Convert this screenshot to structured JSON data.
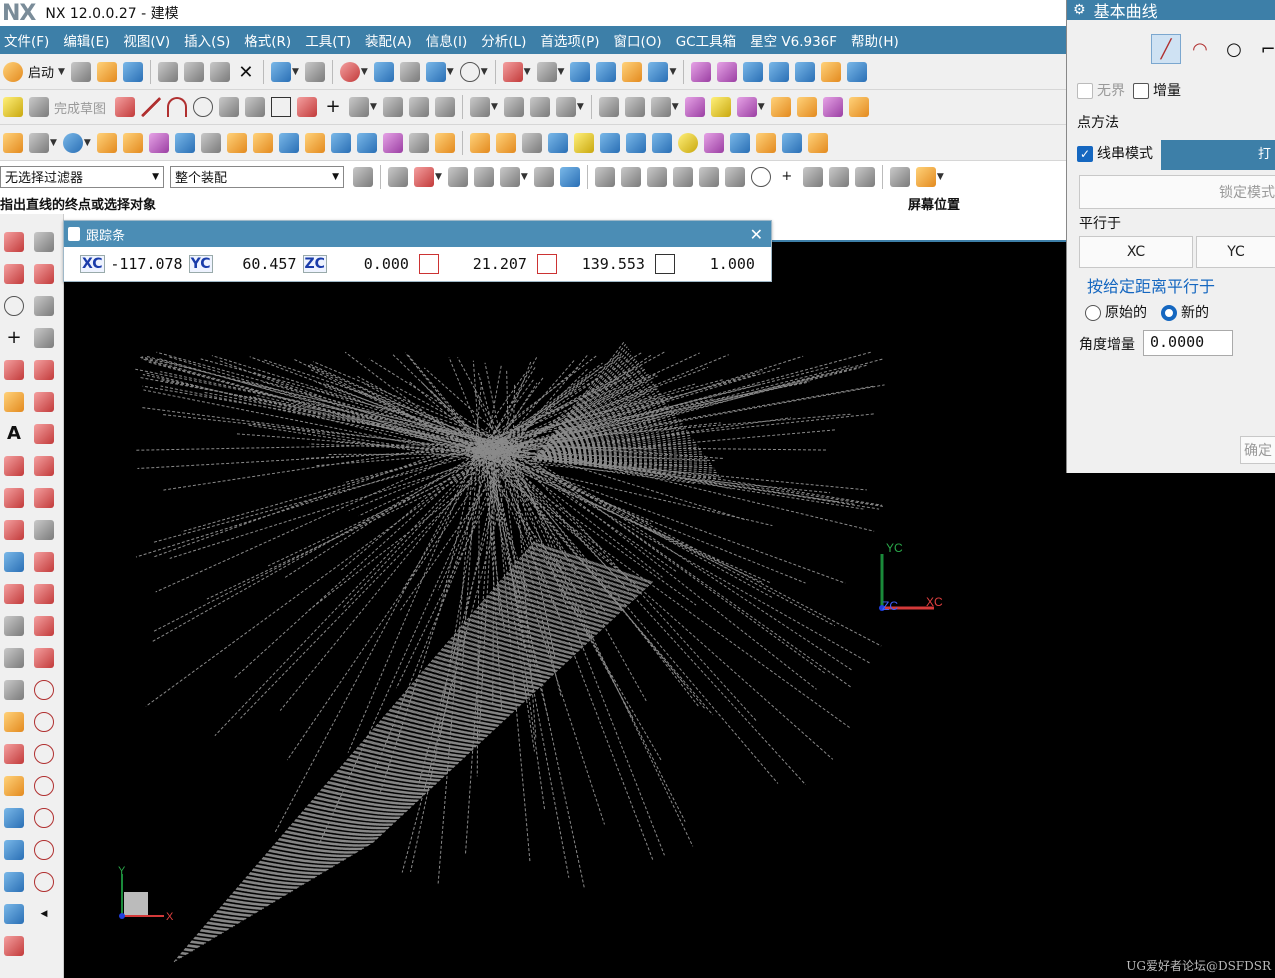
{
  "app": {
    "logo": "NX",
    "title": "NX 12.0.0.27 - 建模"
  },
  "menu": [
    "文件(F)",
    "编辑(E)",
    "视图(V)",
    "插入(S)",
    "格式(R)",
    "工具(T)",
    "装配(A)",
    "信息(I)",
    "分析(L)",
    "首选项(P)",
    "窗口(O)",
    "GC工具箱",
    "星空 V6.936F",
    "帮助(H)"
  ],
  "toolbar": {
    "start_label": "启动",
    "finish_sketch_label": "完成草图",
    "filter_value": "无选择过滤器",
    "assembly_value": "整个装配"
  },
  "cue": {
    "prompt": "指出直线的终点或选择对象",
    "status": "屏幕位置"
  },
  "tracking_bar": {
    "title": "跟踪条",
    "xc_label": "XC",
    "xc_value": "-117.078",
    "yc_label": "YC",
    "yc_value": "60.457",
    "zc_label": "ZC",
    "zc_value": "0.000",
    "length_value": "21.207",
    "angle_value": "139.553",
    "offset_value": "1.000"
  },
  "panel": {
    "title": "基本曲线",
    "unbounded_label": "无界",
    "increment_label": "增量",
    "point_method_label": "点方法",
    "string_mode_label": "线串模式",
    "string_mode_checked": true,
    "action_button": "打",
    "lock_mode_button": "锁定模式",
    "parallel_to_label": "平行于",
    "xc_button": "XC",
    "yc_button": "YC",
    "parallel_distance_label": "按给定距离平行于",
    "original_label": "原始的",
    "new_label": "新的",
    "angle_increment_label": "角度增量",
    "angle_increment_value": "0.0000",
    "ok_button": "确定"
  },
  "viewport": {
    "wcs_yc": "YC",
    "wcs_xc": "XC",
    "wcs_zc": "ZC",
    "triad_y": "Y",
    "triad_x": "X"
  },
  "watermark": "UG爱好者论坛@DSFDSR",
  "colors": {
    "menubar": "#3d7fa8",
    "accent": "#1567c0",
    "mesh": "#8a8a8a"
  }
}
